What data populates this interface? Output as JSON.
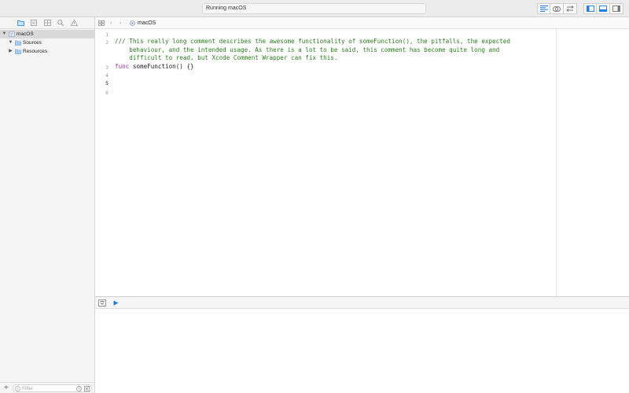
{
  "toolbar": {
    "activity_text": "Running macOS"
  },
  "navigator": {
    "tree": [
      {
        "label": "macOS",
        "expanded": true,
        "selected": true,
        "icon": "project-icon"
      },
      {
        "label": "Sources",
        "expanded": true,
        "selected": false,
        "icon": "folder-icon"
      },
      {
        "label": "Resources",
        "expanded": false,
        "selected": false,
        "icon": "folder-icon"
      }
    ],
    "filter_placeholder": "Filter"
  },
  "jumpbar": {
    "label": "macOS"
  },
  "editor": {
    "line_numbers": [
      "1",
      "2",
      "3",
      "4",
      "5",
      "6"
    ],
    "current_line": "5",
    "code_lines": {
      "l2a": "/// This really long comment describes the awesome functionality of someFunction(), the pitfalls, the expected",
      "l2b": "    behaviour, and the intended usage. As there is a lot to be said, this comment has become quite long and",
      "l2c": "    difficult to read, but Xcode Comment Wrapper can fix this.",
      "l3_keyword": "func",
      "l3_rest": " someFunction() {}"
    }
  },
  "colors": {
    "comment": "#2b7f1e",
    "keyword": "#a233a3",
    "accent": "#1a7ee6"
  }
}
